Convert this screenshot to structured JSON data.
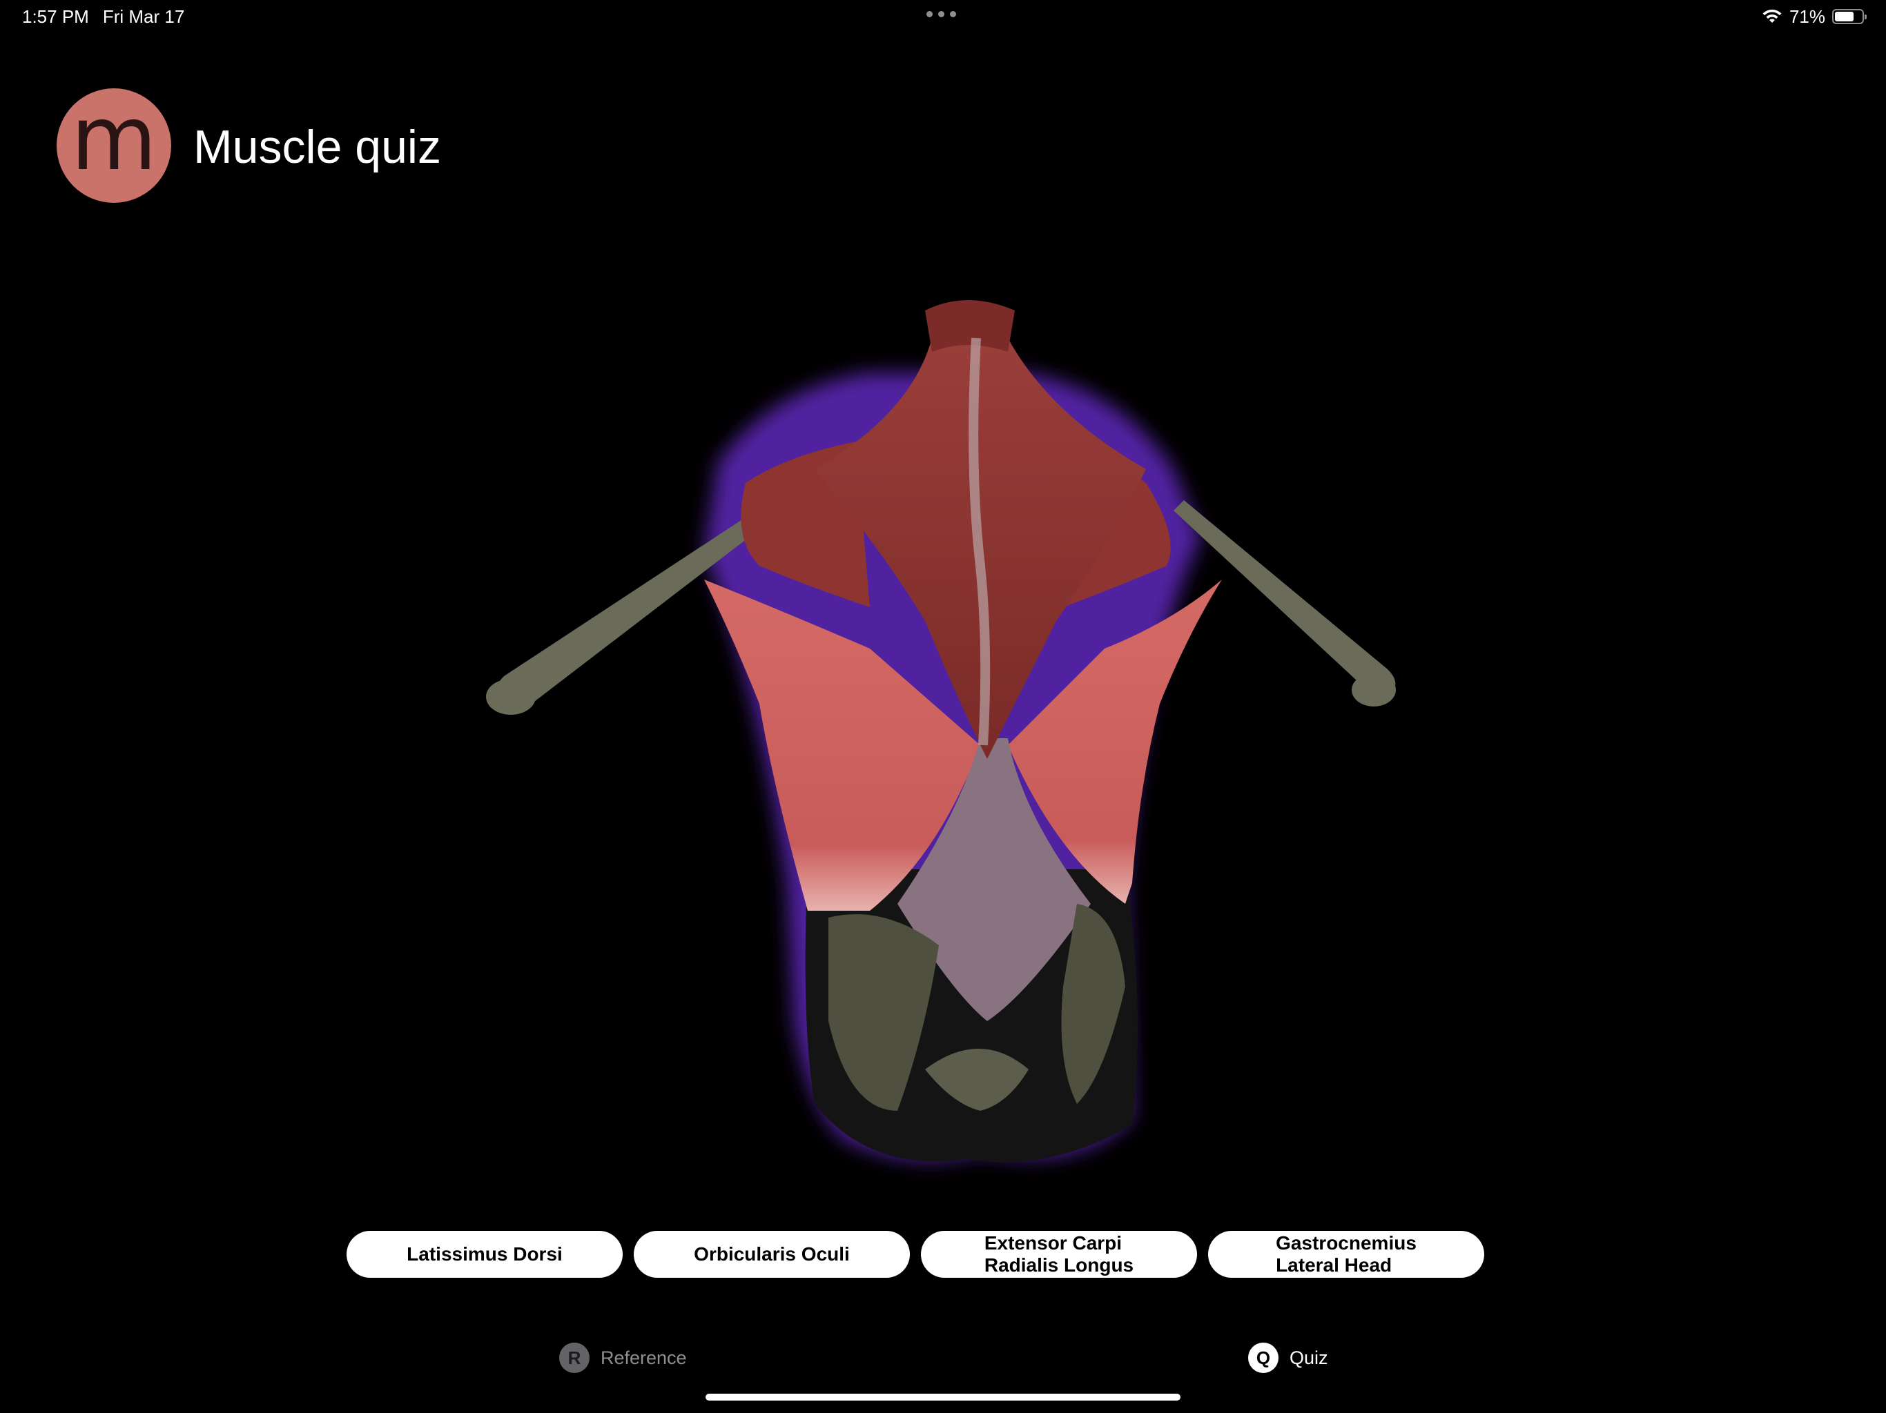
{
  "status_bar": {
    "time": "1:57 PM",
    "date": "Fri Mar 17",
    "battery": "71%",
    "battery_level": 0.71
  },
  "header": {
    "logo_letter": "m",
    "title": "Muscle quiz"
  },
  "answers": [
    "Latissimus Dorsi",
    "Orbicularis Oculi",
    "Extensor Carpi\nRadialis Longus",
    "Gastrocnemius\nLateral Head"
  ],
  "tabs": [
    {
      "badge": "R",
      "label": "Reference"
    },
    {
      "badge": "Q",
      "label": "Quiz"
    }
  ],
  "colors": {
    "background": "#000000",
    "logo": "#c9736a",
    "muscle": "#c05a55",
    "highlight_glow": "#7b3cff",
    "bone": "#6f6f5e"
  }
}
